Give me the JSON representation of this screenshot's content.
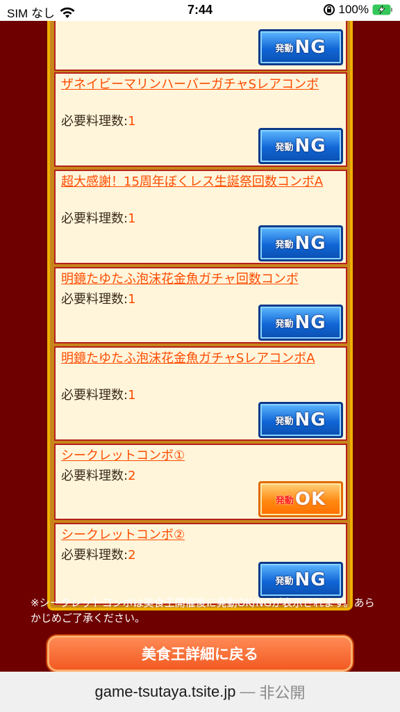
{
  "status_bar": {
    "carrier": "SIM なし",
    "time": "7:44",
    "battery": "100%"
  },
  "combos": [
    {
      "title": "",
      "req_label": "",
      "req_value": "",
      "button": "NG",
      "button_small": "発動"
    },
    {
      "title": "ザネイビーマリンハーバーガチャSレアコンボ",
      "req_label": "必要料理数:",
      "req_value": "1",
      "button": "NG",
      "button_small": "発動"
    },
    {
      "title": "超大感謝！15周年ぼくレス生誕祭回数コンボA",
      "req_label": "必要料理数:",
      "req_value": "1",
      "button": "NG",
      "button_small": "発動"
    },
    {
      "title": "明鏡たゆたふ泡沫花金魚ガチャ回数コンボ",
      "req_label": "必要料理数:",
      "req_value": "1",
      "button": "NG",
      "button_small": "発動"
    },
    {
      "title": "明鏡たゆたふ泡沫花金魚ガチャSレアコンボA",
      "req_label": "必要料理数:",
      "req_value": "1",
      "button": "NG",
      "button_small": "発動"
    },
    {
      "title": "シークレットコンボ①",
      "req_label": "必要料理数:",
      "req_value": "2",
      "button": "OK",
      "button_small": "発動"
    },
    {
      "title": "シークレットコンボ②",
      "req_label": "必要料理数:",
      "req_value": "2",
      "button": "NG",
      "button_small": "発動"
    }
  ],
  "note": "※シークレットコンボは美食王開催後に発動OK/NGが表示されます。あらかじめご了承ください。",
  "back_button": "美食王詳細に戻る",
  "url_bar": {
    "domain": "game-tsutaya.tsite.jp",
    "separator": "—",
    "visibility": "非公開"
  },
  "colors": {
    "background": "#6e0000",
    "link": "#ff4c00",
    "card": "#fff5db",
    "ng_blue": "#1166d6",
    "ok_orange": "#ff8a12",
    "panel_border": "#f0b000"
  }
}
